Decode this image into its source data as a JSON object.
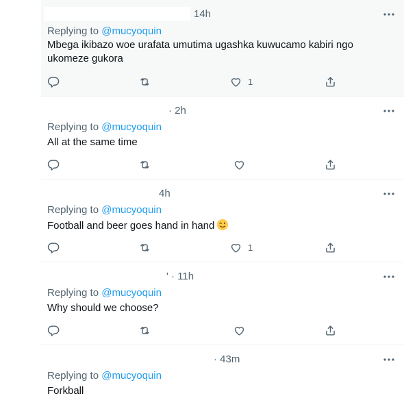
{
  "thread": {
    "replies": [
      {
        "time": "14h",
        "replying_to_label": "Replying to",
        "replying_to_handle": "@mucyoquin",
        "text_line1": "Mbega ikibazo woe urafata umutima ugashka kuwucamo kabiri ngo",
        "text_line2": "ukomeze gukora",
        "like_count": "1",
        "more_icon": "more-horizontal-icon"
      },
      {
        "time": "· 2h",
        "replying_to_label": "Replying to",
        "replying_to_handle": "@mucyoquin",
        "text_line1": "All at the same time",
        "like_count": "",
        "more_icon": "more-horizontal-icon"
      },
      {
        "time": "4h",
        "replying_to_label": "Replying to",
        "replying_to_handle": "@mucyoquin",
        "text_line1": "Football and beer goes hand in hand",
        "emoji": "winking-face-emoji",
        "like_count": "1",
        "more_icon": "more-horizontal-icon"
      },
      {
        "time": "' · 11h",
        "replying_to_label": "Replying to",
        "replying_to_handle": "@mucyoquin",
        "text_line1": "Why should we choose?",
        "like_count": "",
        "more_icon": "more-horizontal-icon"
      },
      {
        "time": "· 43m",
        "replying_to_label": "Replying to",
        "replying_to_handle": "@mucyoquin",
        "text_line1": "Forkball",
        "more_icon": "more-horizontal-icon"
      }
    ]
  },
  "icons": {
    "reply": "reply-icon",
    "retweet": "retweet-icon",
    "like": "heart-icon",
    "share": "share-icon"
  },
  "colors": {
    "highlight_bg": "#f7f9f9",
    "link": "#1d9bf0",
    "secondary_text": "#536471",
    "primary_text": "#0f1419",
    "divider": "#eff3f4"
  }
}
